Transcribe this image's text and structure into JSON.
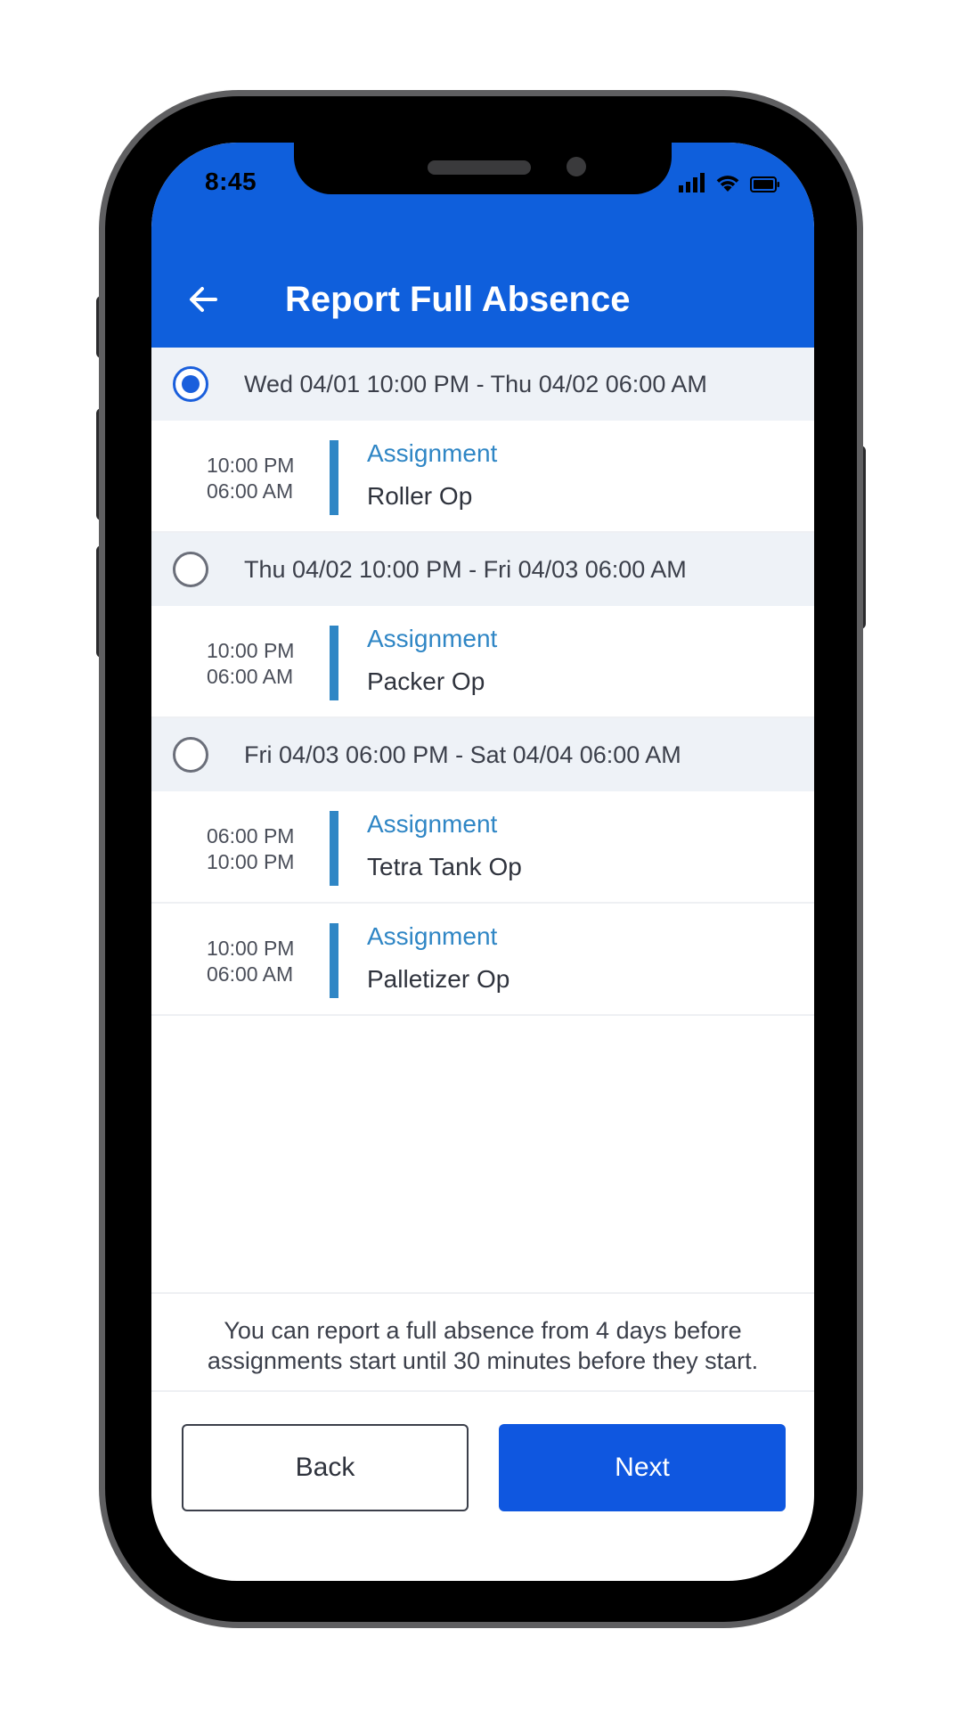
{
  "status_bar": {
    "time": "8:45",
    "icons": [
      "cellular-signal-icon",
      "wifi-icon",
      "battery-icon"
    ]
  },
  "header": {
    "title": "Report Full Absence",
    "back_icon": "arrow-left-icon"
  },
  "groups": [
    {
      "label": "Wed 04/01 10:00 PM - Thu 04/02 06:00 AM",
      "selected": true,
      "assignments": [
        {
          "start": "10:00 PM",
          "end": "06:00 AM",
          "type": "Assignment",
          "name": "Roller Op"
        }
      ]
    },
    {
      "label": "Thu 04/02 10:00 PM - Fri 04/03 06:00 AM",
      "selected": false,
      "assignments": [
        {
          "start": "10:00 PM",
          "end": "06:00 AM",
          "type": "Assignment",
          "name": "Packer Op"
        }
      ]
    },
    {
      "label": "Fri 04/03 06:00 PM - Sat 04/04 06:00 AM",
      "selected": false,
      "assignments": [
        {
          "start": "06:00 PM",
          "end": "10:00 PM",
          "type": "Assignment",
          "name": "Tetra Tank Op"
        },
        {
          "start": "10:00 PM",
          "end": "06:00 AM",
          "type": "Assignment",
          "name": "Palletizer Op"
        }
      ]
    }
  ],
  "info_text": "You can report a full absence from 4 days before assignments start until 30 minutes before they start.",
  "buttons": {
    "back": "Back",
    "next": "Next"
  },
  "colors": {
    "header": "#0f5fdc",
    "accent": "#1a5fdc",
    "assignment_bar": "#2f86c5",
    "group_bg": "#eef2f7",
    "next_button": "#0f57e0"
  }
}
